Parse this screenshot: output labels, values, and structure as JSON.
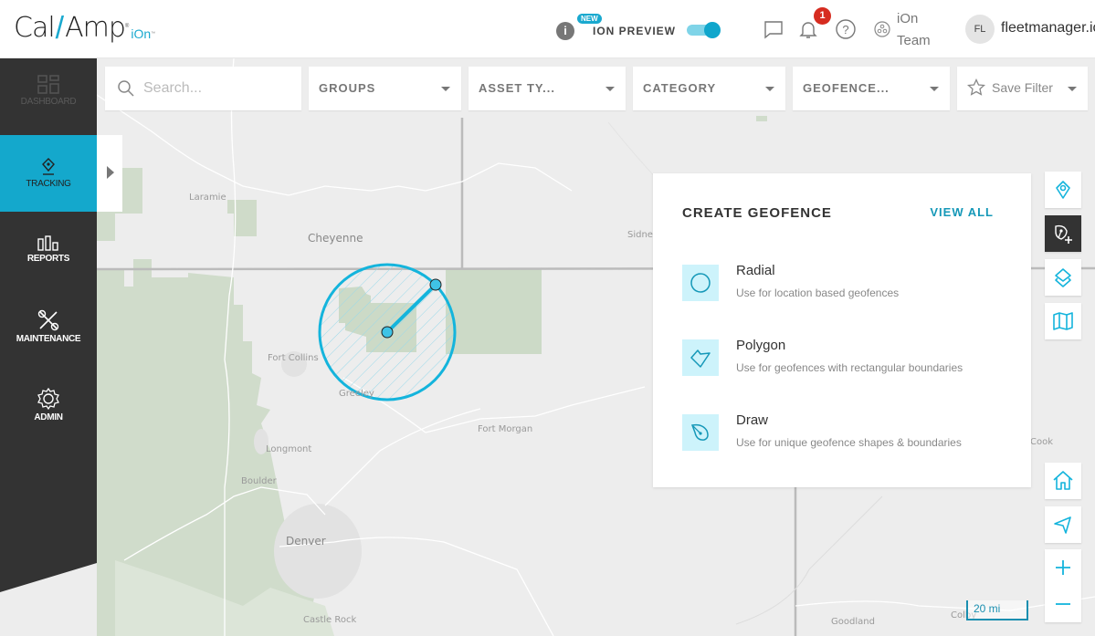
{
  "header": {
    "logo": {
      "main": "Cal",
      "main2": "Amp",
      "reg": "®",
      "sub": "iOn",
      "tm": "™"
    },
    "info_icon": "i",
    "new_badge": "NEW",
    "preview_label": "ION PREVIEW",
    "preview_toggle_on": true,
    "notification_count": "1",
    "team_line1": "iOn",
    "team_line2": "Team",
    "avatar_initials": "FL",
    "user_name": "fleetmanager.io"
  },
  "sidebar": {
    "items": [
      {
        "label": "DASHBOARD",
        "icon": "dashboard-icon",
        "disabled": true
      },
      {
        "label": "TRACKING",
        "icon": "location-pin-icon",
        "active": true
      },
      {
        "label": "REPORTS",
        "icon": "bar-chart-icon"
      },
      {
        "label": "MAINTENANCE",
        "icon": "tools-icon"
      },
      {
        "label": "ADMIN",
        "icon": "gear-icon"
      }
    ]
  },
  "filters": {
    "search_placeholder": "Search...",
    "groups": "GROUPS",
    "asset_type": "ASSET TY...",
    "category": "CATEGORY",
    "geofence": "GEOFENCE...",
    "save_filter": "Save Filter"
  },
  "geofence_panel": {
    "title": "CREATE GEOFENCE",
    "view_all": "VIEW ALL",
    "options": [
      {
        "title": "Radial",
        "description": "Use for location based geofences",
        "icon": "circle-icon"
      },
      {
        "title": "Polygon",
        "description": "Use for geofences with rectangular boundaries",
        "icon": "polygon-icon"
      },
      {
        "title": "Draw",
        "description": "Use for unique geofence shapes & boundaries",
        "icon": "draw-pen-icon"
      }
    ]
  },
  "map": {
    "labels": {
      "laramie": "Laramie",
      "cheyenne": "Cheyenne",
      "sidney": "Sidney",
      "fort_collins": "Fort Collins",
      "greeley": "Greeley",
      "fort_morgan": "Fort Morgan",
      "longmont": "Longmont",
      "boulder": "Boulder",
      "denver": "Denver",
      "castle_rock": "Castle Rock",
      "goodland": "Goodland",
      "colby": "Colby",
      "brook": "Cook"
    },
    "scale_label": "20 mi",
    "accent_color": "#14b4dc"
  },
  "map_controls": [
    "locate-asset-icon",
    "create-geofence-icon",
    "layers-icon",
    "map-icon",
    "home-icon",
    "navigate-icon",
    "zoom-in-icon",
    "zoom-out-icon"
  ]
}
